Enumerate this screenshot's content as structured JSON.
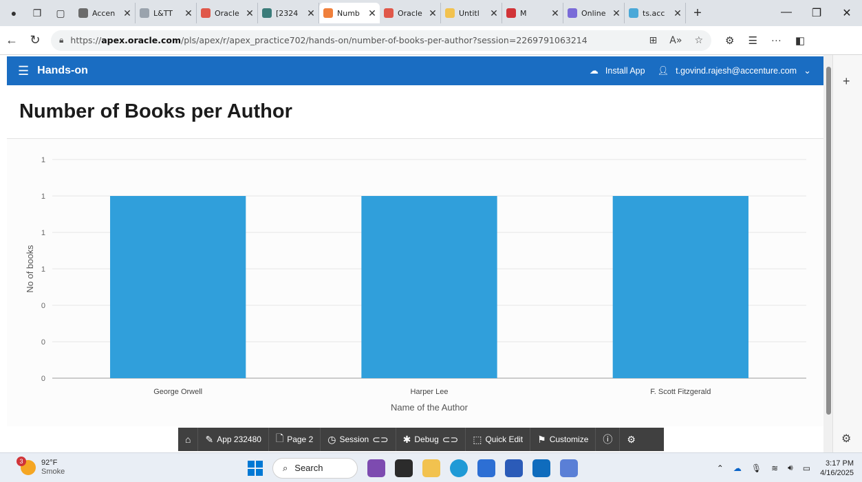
{
  "browser": {
    "tabs": [
      {
        "title": "Accen",
        "color": "#6b6b6b"
      },
      {
        "title": "L&TT",
        "color": "#9aa3ad"
      },
      {
        "title": "Oracle",
        "color": "#e0584a"
      },
      {
        "title": "[2324",
        "color": "#3b7c7a"
      },
      {
        "title": "Numb",
        "color": "#f0803c",
        "active": true
      },
      {
        "title": "Oracle",
        "color": "#e0584a"
      },
      {
        "title": "Untitl",
        "color": "#f2c24f"
      },
      {
        "title": "M",
        "color": "#d13438"
      },
      {
        "title": "Online",
        "color": "#7a6bd8"
      },
      {
        "title": "ts.acc",
        "color": "#4aa8d8"
      }
    ],
    "url_prefix": "https://",
    "url_host": "apex.oracle.com",
    "url_path": "/pls/apex/r/apex_practice702/hands-on/number-of-books-per-author?session=2269791063214"
  },
  "header": {
    "app_name": "Hands-on",
    "install_app": "Install App",
    "user": "t.govind.rajesh@accenture.com"
  },
  "page": {
    "title": "Number of Books per Author"
  },
  "chart_data": {
    "type": "bar",
    "categories": [
      "George Orwell",
      "Harper Lee",
      "F. Scott Fitzgerald"
    ],
    "values": [
      1,
      1,
      1
    ],
    "xlabel": "Name of the Author",
    "ylabel": "No of books",
    "y_tick_labels": [
      "0",
      "0",
      "0",
      "1",
      "1",
      "1",
      "1"
    ],
    "ylim": [
      0,
      1.2
    ],
    "grid": true,
    "bar_color": "#309fdb"
  },
  "dev_toolbar": {
    "app": "App 232480",
    "page": "Page 2",
    "session": "Session",
    "debug": "Debug",
    "quick_edit": "Quick Edit",
    "customize": "Customize"
  },
  "taskbar": {
    "weather_badge": "3",
    "temp": "92°F",
    "condition": "Smoke",
    "search": "Search",
    "time": "3:17 PM",
    "date": "4/16/2025"
  }
}
